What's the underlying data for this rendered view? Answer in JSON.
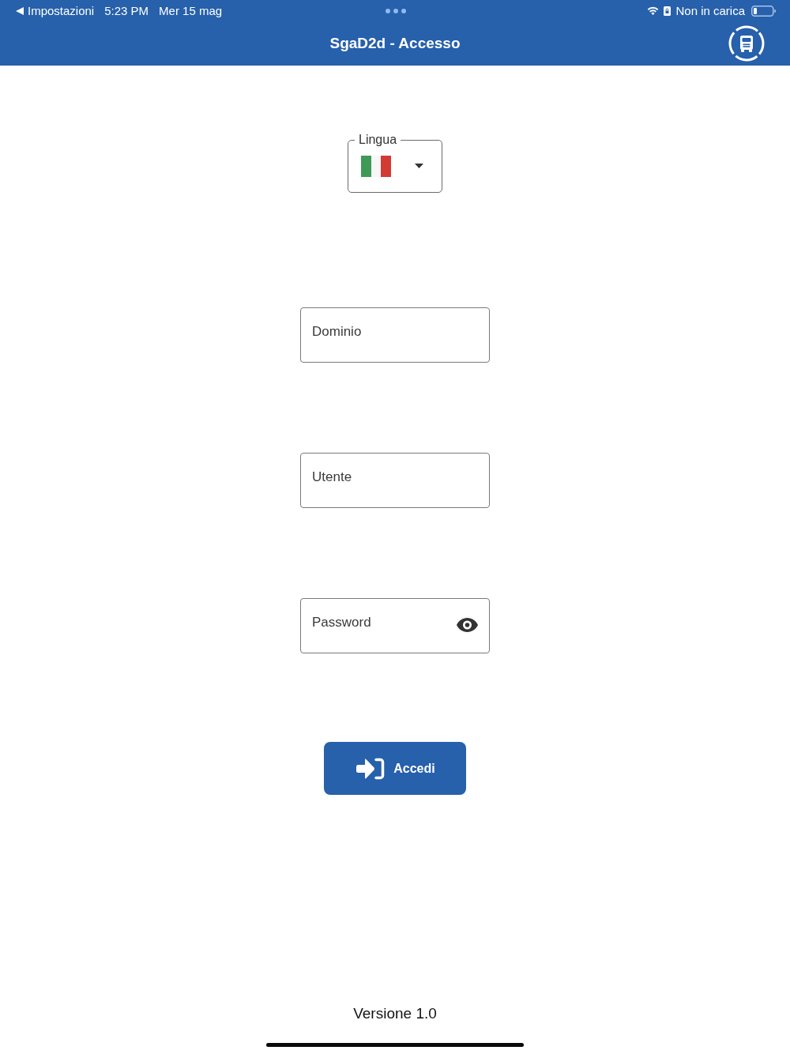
{
  "status_bar": {
    "back_label": "Impostazioni",
    "time": "5:23 PM",
    "date": "Mer 15 mag",
    "battery_status": "Non in carica"
  },
  "header": {
    "title": "SgaD2d - Accesso"
  },
  "language": {
    "label": "Lingua"
  },
  "fields": [
    {
      "kind": "text",
      "placeholder": "Dominio"
    },
    {
      "kind": "text",
      "placeholder": "Utente"
    },
    {
      "kind": "password",
      "placeholder": "Password"
    }
  ],
  "login_button": {
    "label": "Accedi"
  },
  "footer": {
    "version": "Versione 1.0"
  }
}
